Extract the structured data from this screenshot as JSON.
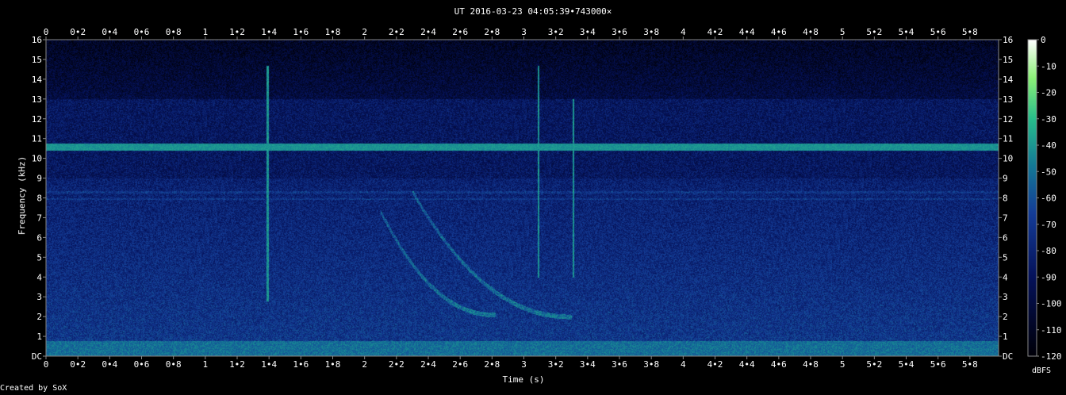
{
  "title": "UT 2016-03-23 04:05:39•743000×",
  "credit": "Created by SoX",
  "chart_data": {
    "type": "heatmap",
    "title": "UT 2016-03-23 04:05:39•743000×",
    "xlabel": "Time (s)",
    "ylabel": "Frequency (kHz)",
    "xlim": [
      0,
      5.98
    ],
    "ylim": [
      0,
      16
    ],
    "x_ticks": [
      "0",
      "0•2",
      "0•4",
      "0•6",
      "0•8",
      "1",
      "1•2",
      "1•4",
      "1•6",
      "1•8",
      "2",
      "2•2",
      "2•4",
      "2•6",
      "2•8",
      "3",
      "3•2",
      "3•4",
      "3•6",
      "3•8",
      "4",
      "4•2",
      "4•4",
      "4•6",
      "4•8",
      "5",
      "5•2",
      "5•4",
      "5•6",
      "5•8"
    ],
    "y_ticks": [
      "DC",
      "1",
      "2",
      "3",
      "4",
      "5",
      "6",
      "7",
      "8",
      "9",
      "10",
      "11",
      "12",
      "13",
      "14",
      "15",
      "16"
    ],
    "colorbar": {
      "label": "dBFS",
      "range": [
        -120,
        0
      ],
      "ticks": [
        "0",
        "-10",
        "-20",
        "-30",
        "-40",
        "-50",
        "-60",
        "-70",
        "-80",
        "-90",
        "-100",
        "-110",
        "-120"
      ]
    },
    "features": {
      "steady_tone_khz": 10.6,
      "weak_tone_khz": [
        8.3,
        7.95
      ],
      "low_band_khz": [
        0,
        0.8
      ],
      "spikes": [
        {
          "t": 1.39,
          "f_min": 2.8,
          "f_max": 14.7
        },
        {
          "t": 3.09,
          "f_min": 4.0,
          "f_max": 14.7
        },
        {
          "t": 3.31,
          "f_min": 4.0,
          "f_max": 13.0
        }
      ],
      "whistlers": [
        {
          "t_start": 2.1,
          "t_end": 2.82,
          "f_start": 7.3,
          "f_end": 2.1
        },
        {
          "t_start": 2.3,
          "t_end": 3.3,
          "f_start": 8.3,
          "f_end": 2.0
        }
      ]
    }
  }
}
